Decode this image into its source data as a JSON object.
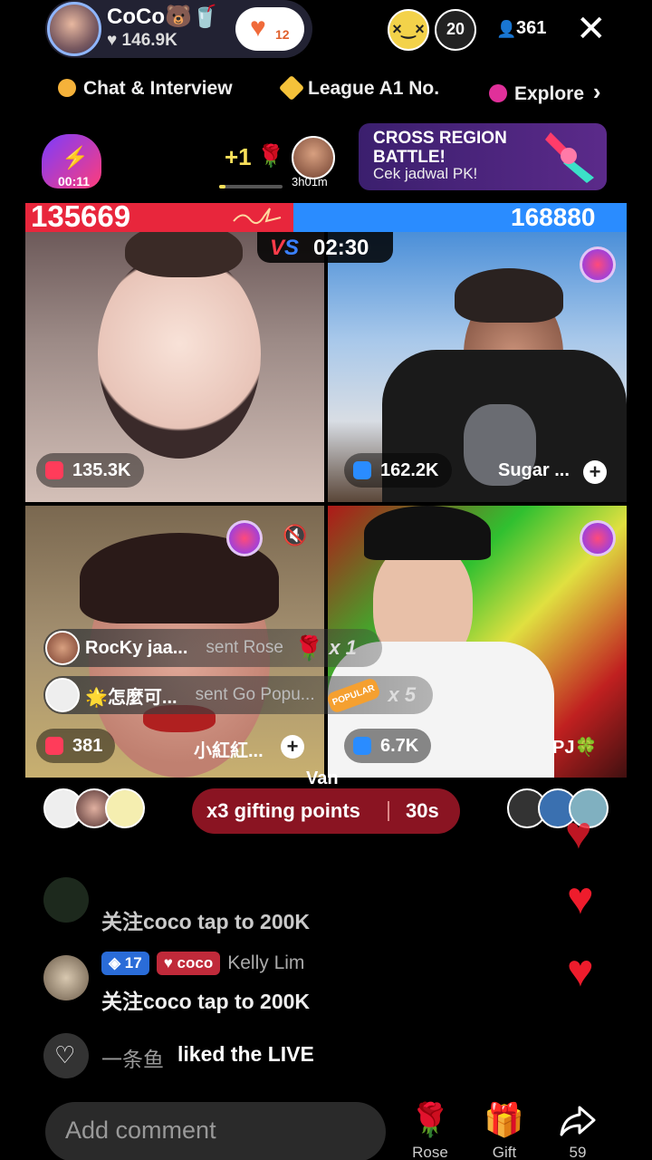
{
  "header": {
    "host_name": "CoCo🐻🥤",
    "host_likes": "♥ 146.9K",
    "heart_count": "12",
    "viewer_badge_1": "",
    "viewer_badge_2": "20",
    "viewer_count": "361",
    "close_symbol": "✕"
  },
  "topics": [
    {
      "label": "Chat & Interview",
      "color": "#f5b23a"
    },
    {
      "label": "League A1 No.",
      "color": "#f5c23a"
    },
    {
      "label": "Explore",
      "color": "#e0309a"
    }
  ],
  "explore_chevron": "›",
  "rank": {
    "time": "00:11",
    "plus": "+1",
    "rose": "🌹",
    "timer": "3h01m",
    "progress_fraction": 0.1
  },
  "pk_banner": {
    "title": "CROSS REGION BATTLE!",
    "subtitle": "Cek jadwal PK!"
  },
  "battle": {
    "score_left": "135669",
    "score_right": "168880",
    "vs_label": "VS",
    "countdown": "02:30",
    "red_share": 0.4455
  },
  "tiles": [
    {
      "points": "135.3K",
      "icon_color": "#ff3c5a"
    },
    {
      "points": "162.2K",
      "name": "Sugar ...",
      "icon_color": "#2a8cff"
    },
    {
      "points": "381",
      "name": "小紅紅...",
      "icon_color": "#ff3c5a"
    },
    {
      "points": "6.7K",
      "name": "PJ🍀",
      "icon_color": "#2a8cff"
    }
  ],
  "gift_notifications": [
    {
      "user": "RocKy jaa...",
      "action": "sent Rose",
      "gift": "🌹",
      "multiplier": "x 1"
    },
    {
      "user": "🌟怎麼可...",
      "action": "sent Go Popu...",
      "gift": "POPULAR",
      "multiplier": "x 5"
    }
  ],
  "overlay_text": "Van",
  "gifting": {
    "label": "x3 gifting points",
    "time": "30s"
  },
  "chat": [
    {
      "text": "关注coco  tap to 200K"
    },
    {
      "level": "17",
      "fan_badge": "coco",
      "name": "Kelly Lim",
      "text": "关注coco  tap to 200K"
    }
  ],
  "liked": {
    "name": "一条鱼",
    "text": "liked the LIVE"
  },
  "bottom": {
    "comment_placeholder": "Add comment",
    "rose_label": "Rose",
    "gift_label": "Gift",
    "share_count": "59"
  }
}
